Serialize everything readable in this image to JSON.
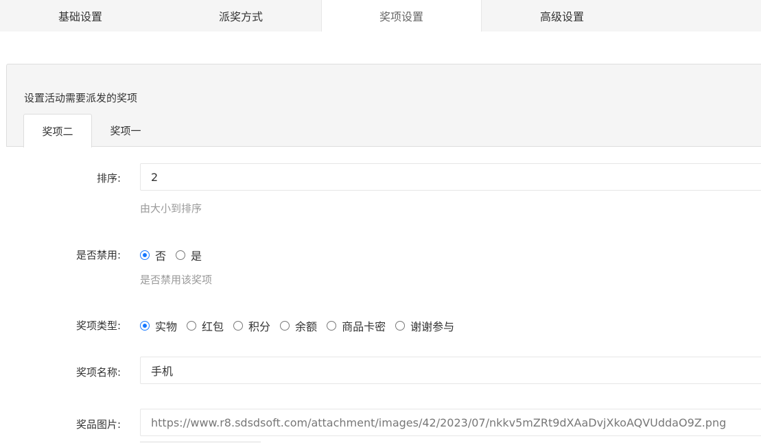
{
  "top_tabs": [
    {
      "label": "基础设置"
    },
    {
      "label": "派奖方式"
    },
    {
      "label": "奖项设置"
    },
    {
      "label": "高级设置"
    }
  ],
  "panel": {
    "title": "设置活动需要派发的奖项",
    "tabs": [
      {
        "label": "奖项二"
      },
      {
        "label": "奖项一"
      }
    ]
  },
  "form": {
    "sort": {
      "label": "排序:",
      "value": "2",
      "help": "由大小到排序"
    },
    "disabled": {
      "label": "是否禁用:",
      "options": [
        "否",
        "是"
      ],
      "help": "是否禁用该奖项"
    },
    "prize_type": {
      "label": "奖项类型:",
      "options": [
        "实物",
        "红包",
        "积分",
        "余额",
        "商品卡密",
        "谢谢参与"
      ]
    },
    "prize_name": {
      "label": "奖项名称:",
      "value": "手机"
    },
    "prize_image": {
      "label": "奖品图片:",
      "value": "https://www.r8.sdsdsoft.com/attachment/images/42/2023/07/nkkv5mZRt9dXAaDvjXkoAQVUddaO9Z.png"
    }
  },
  "colors": {
    "accent": "#1677ff",
    "help_text": "#999999",
    "tab_bg": "#f5f5f5"
  }
}
